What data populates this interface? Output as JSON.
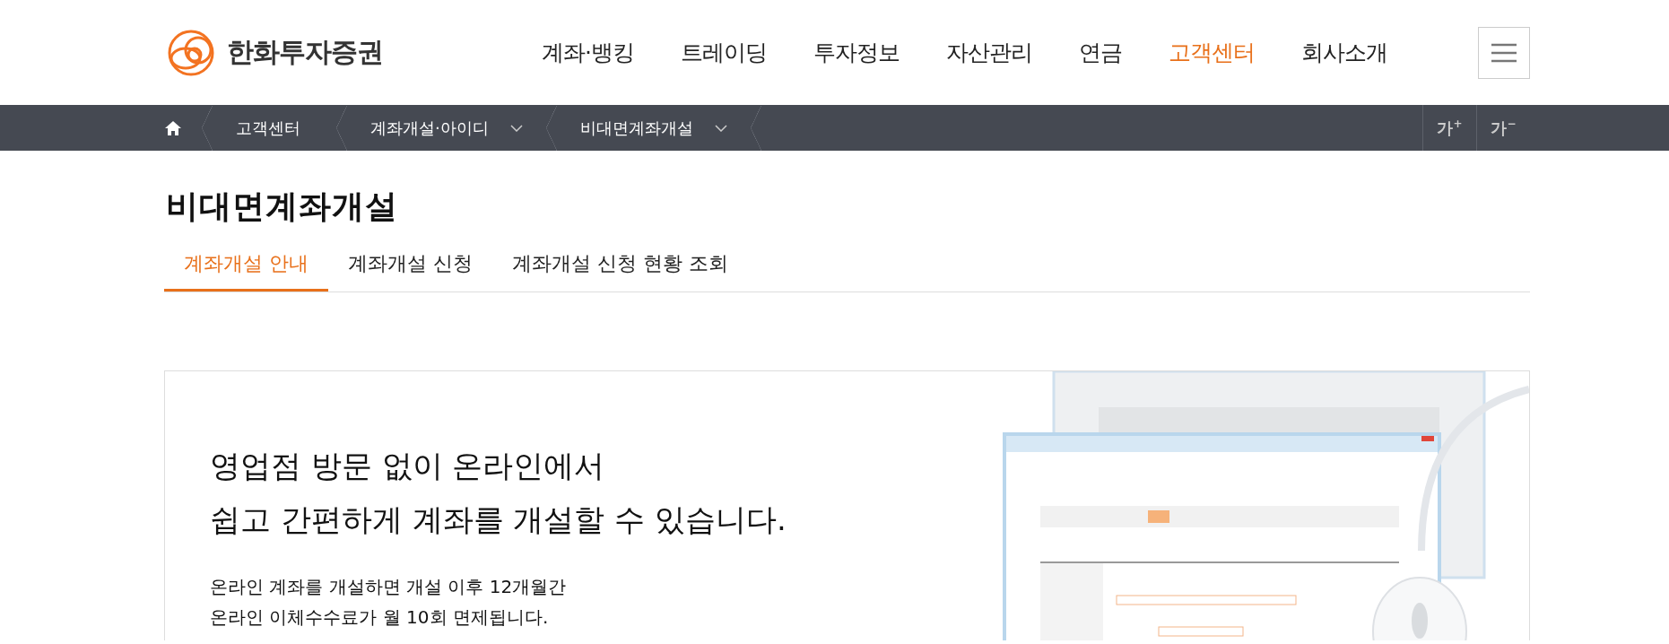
{
  "logo": {
    "text": "한화투자증권"
  },
  "nav": [
    {
      "label": "계좌·뱅킹",
      "selected": false
    },
    {
      "label": "트레이딩",
      "selected": false
    },
    {
      "label": "투자정보",
      "selected": false
    },
    {
      "label": "자산관리",
      "selected": false
    },
    {
      "label": "연금",
      "selected": false
    },
    {
      "label": "고객센터",
      "selected": true
    },
    {
      "label": "회사소개",
      "selected": false
    }
  ],
  "breadcrumb": [
    {
      "label": "고객센터",
      "dropdown": false
    },
    {
      "label": "계좌개설·아이디",
      "dropdown": true
    },
    {
      "label": "비대면계좌개설",
      "dropdown": true
    }
  ],
  "font_buttons": [
    "가$^{+}$",
    "가$^{−}$"
  ],
  "page_title": "비대면계좌개설",
  "tabs": [
    {
      "label": "계좌개설 안내",
      "selected": true
    },
    {
      "label": "계좌개설 신청",
      "selected": false
    },
    {
      "label": "계좌개설 신청 현황 조회",
      "selected": false
    }
  ],
  "hero": {
    "headline": [
      "영업점 방문 없이 온라인에서",
      "쉽고 간편하게 계좌를 개설할 수 있습니다."
    ],
    "body": [
      "온라인 계좌를 개설하면 개설 이후 12개월간",
      "온라인 이체수수료가 월 10회 면제됩니다."
    ],
    "image": {
      "kind": "picture"
    }
  }
}
